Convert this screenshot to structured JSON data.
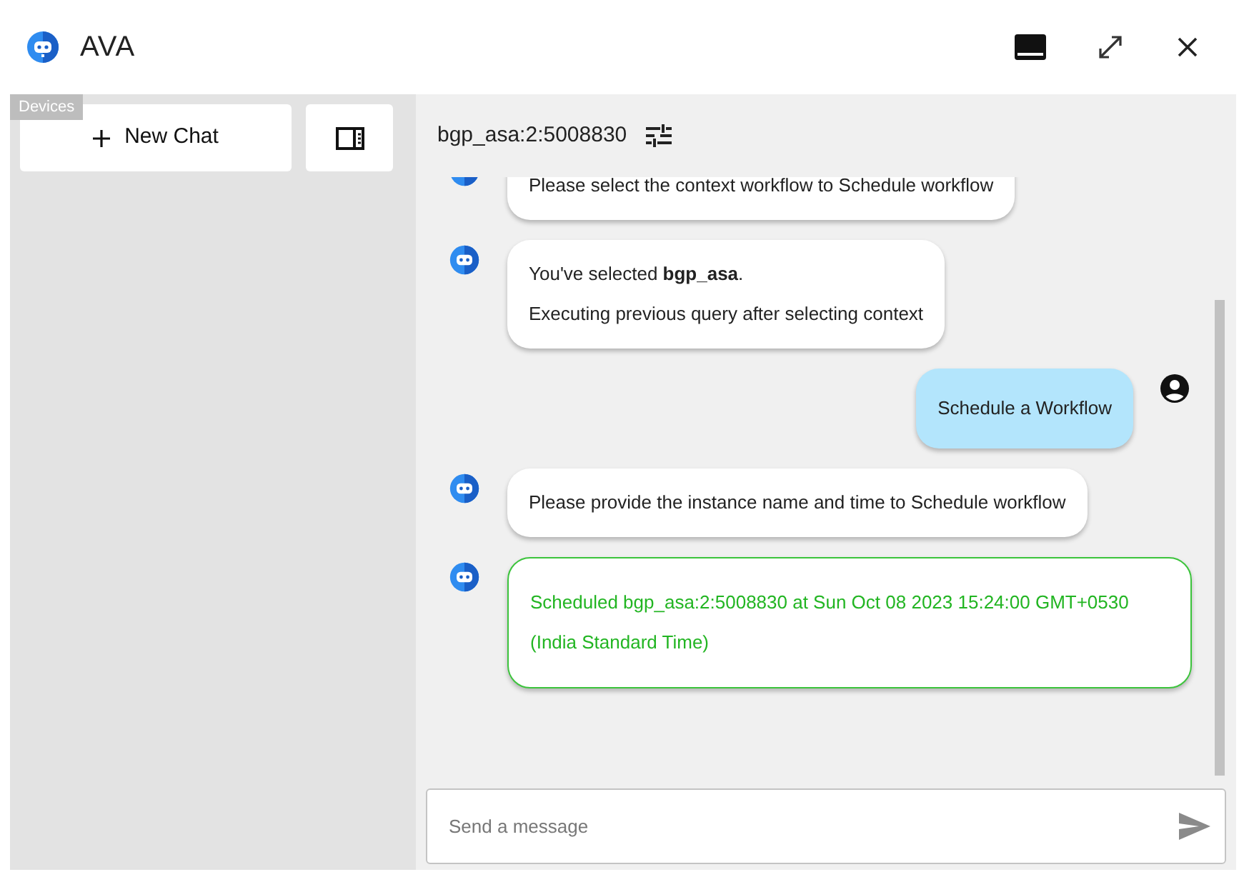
{
  "window": {
    "title": "AVA"
  },
  "sidebar": {
    "tooltip": "Devices",
    "new_chat_button": "New Chat"
  },
  "chat": {
    "context": "bgp_asa:2:5008830",
    "messages": [
      {
        "kind": "bot",
        "success": false,
        "lines": [
          "Please select the context workflow to Schedule workflow"
        ]
      },
      {
        "kind": "bot",
        "success": false,
        "lines": [
          "You've selected **bgp_asa**.",
          "Executing previous query after selecting context"
        ]
      },
      {
        "kind": "user",
        "success": false,
        "lines": [
          "Schedule a Workflow"
        ]
      },
      {
        "kind": "bot",
        "success": false,
        "lines": [
          "Please provide the instance name and time to Schedule workflow"
        ]
      },
      {
        "kind": "bot",
        "success": true,
        "lines": [
          "Scheduled bgp_asa:2:5008830 at Sun Oct 08 2023 15:24:00 GMT+0530 (India Standard Time)"
        ]
      }
    ],
    "input": {
      "placeholder": "Send a message"
    }
  }
}
